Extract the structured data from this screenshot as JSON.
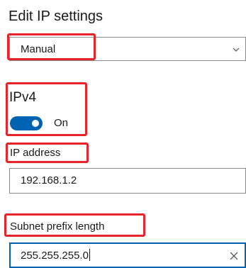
{
  "page": {
    "title": "Edit IP settings"
  },
  "mode_select": {
    "value": "Manual",
    "icon": "chevron-down-icon"
  },
  "ipv4": {
    "title": "IPv4",
    "toggle_state": "On",
    "toggle_on": true,
    "accent_color": "#0063b1"
  },
  "ip_address": {
    "label": "IP address",
    "value": "192.168.1.2"
  },
  "subnet": {
    "label": "Subnet prefix length",
    "value": "255.255.255.0",
    "clear_icon": "close-icon"
  },
  "highlight_color": "#e8232a"
}
